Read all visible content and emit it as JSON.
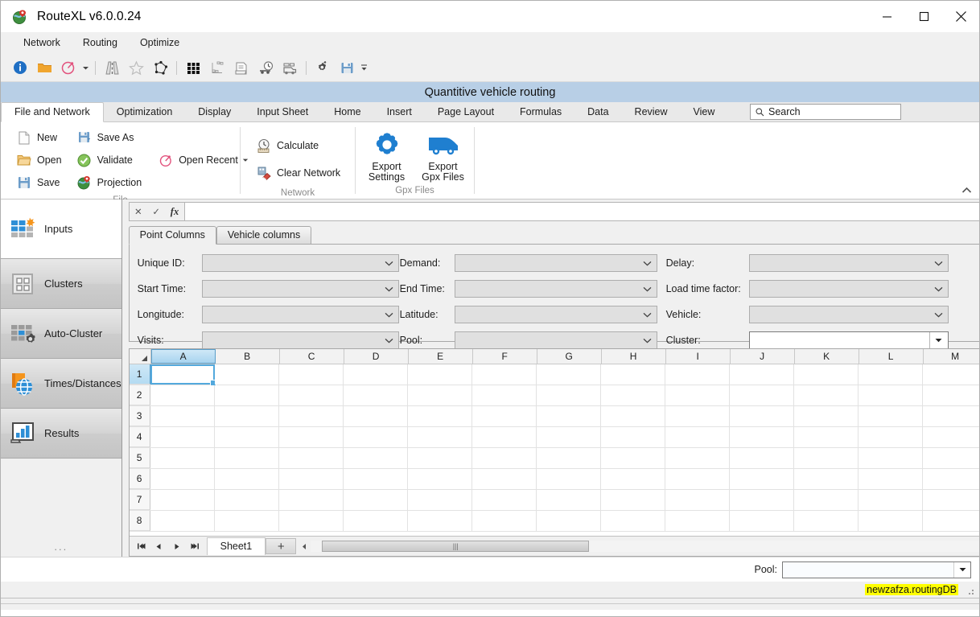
{
  "window": {
    "title": "RouteXL v6.0.0.24",
    "app_icon": "globe-marker-icon",
    "minimize": "minimize-icon",
    "maximize": "maximize-icon",
    "close": "close-icon"
  },
  "menubar": {
    "items": [
      {
        "label": "Network"
      },
      {
        "label": "Routing"
      },
      {
        "label": "Optimize"
      }
    ]
  },
  "toolstrip": {
    "buttons": [
      {
        "name": "info-icon"
      },
      {
        "name": "open-folder-icon"
      },
      {
        "name": "compass-icon"
      },
      {
        "name": "compass-dropdown-caret-icon"
      },
      {
        "name": "separator-1"
      },
      {
        "name": "road-icon"
      },
      {
        "name": "star-icon"
      },
      {
        "name": "polygon-icon"
      },
      {
        "name": "separator-2"
      },
      {
        "name": "matrix-grid-icon"
      },
      {
        "name": "cluster-nodes-icon"
      },
      {
        "name": "report-icon"
      },
      {
        "name": "truck-clock-icon"
      },
      {
        "name": "truck-fleet-icon"
      },
      {
        "name": "separator-3"
      },
      {
        "name": "gears-settings-icon"
      },
      {
        "name": "save-disk-icon"
      },
      {
        "name": "overflow-caret-icon"
      }
    ]
  },
  "banner": {
    "title": "Quantitive vehicle routing"
  },
  "ribbon": {
    "tabs": [
      {
        "label": "File and Network",
        "active": true
      },
      {
        "label": "Optimization",
        "active": false
      },
      {
        "label": "Display",
        "active": false
      },
      {
        "label": "Input Sheet",
        "active": false
      },
      {
        "label": "Home",
        "active": false
      },
      {
        "label": "Insert",
        "active": false
      },
      {
        "label": "Page Layout",
        "active": false
      },
      {
        "label": "Formulas",
        "active": false
      },
      {
        "label": "Data",
        "active": false
      },
      {
        "label": "Review",
        "active": false
      },
      {
        "label": "View",
        "active": false
      }
    ],
    "search": {
      "placeholder": "Search",
      "value": "Search",
      "icon": "search-icon"
    },
    "collapse_icon": "chevron-up-icon",
    "groups": [
      {
        "label": "File",
        "columns": [
          {
            "buttons": [
              {
                "label": "New",
                "icon": "new-document-icon"
              },
              {
                "label": "Open",
                "icon": "open-folder-icon"
              },
              {
                "label": "Save",
                "icon": "save-disk-icon"
              }
            ]
          },
          {
            "buttons": [
              {
                "label": "Save As",
                "icon": "save-as-disk-icon"
              },
              {
                "label": "Validate",
                "icon": "green-check-icon"
              },
              {
                "label": "Projection",
                "icon": "globe-marker-icon"
              }
            ]
          },
          {
            "buttons": [
              {
                "label": "Open Recent",
                "icon": "compass-icon",
                "has_caret": true
              }
            ]
          }
        ]
      },
      {
        "label": "Network",
        "columns": [
          {
            "buttons": [
              {
                "label": "Calculate",
                "icon": "clock-ruler-icon"
              },
              {
                "label": "Clear Network",
                "icon": "eraser-icon"
              }
            ]
          }
        ]
      },
      {
        "label": "Gpx Files",
        "big_buttons": [
          {
            "label": "Export\nSettings",
            "line1": "Export",
            "line2": "Settings",
            "icon": "gear-icon"
          },
          {
            "label": "Export\nGpx Files",
            "line1": "Export",
            "line2": "Gpx Files",
            "icon": "van-icon"
          }
        ]
      }
    ]
  },
  "navpane": {
    "items": [
      {
        "label": "Inputs",
        "icon": "inputs-grid-star-icon",
        "active": true
      },
      {
        "label": "Clusters",
        "icon": "clusters-icon",
        "active": false
      },
      {
        "label": "Auto-Cluster",
        "icon": "auto-cluster-gear-icon",
        "active": false
      },
      {
        "label": "Times/Distances",
        "icon": "times-distances-globe-icon",
        "active": false
      },
      {
        "label": "Results",
        "icon": "results-chart-icon",
        "active": false
      }
    ],
    "overflow": "..."
  },
  "formula_bar": {
    "cancel_icon": "cancel-x-icon",
    "accept_icon": "accept-check-icon",
    "function_icon": "insert-function-icon",
    "value": "",
    "expand_icon": "chevron-down-icon"
  },
  "panel": {
    "tabs": [
      {
        "label": "Point Columns",
        "active": true
      },
      {
        "label": "Vehicle columns",
        "active": false
      }
    ],
    "fields": [
      {
        "label": "Unique ID:",
        "value": "",
        "style": "grey",
        "col": 0,
        "row": 0,
        "icon": "chevron-down-icon"
      },
      {
        "label": "Demand:",
        "value": "",
        "style": "grey",
        "col": 1,
        "row": 0,
        "icon": "chevron-down-icon"
      },
      {
        "label": "Delay:",
        "value": "",
        "style": "grey",
        "col": 2,
        "row": 0,
        "icon": "chevron-down-icon"
      },
      {
        "label": "Start Time:",
        "value": "",
        "style": "grey",
        "col": 0,
        "row": 1,
        "icon": "chevron-down-icon"
      },
      {
        "label": "End Time:",
        "value": "",
        "style": "grey",
        "col": 1,
        "row": 1,
        "icon": "chevron-down-icon"
      },
      {
        "label": "Load time factor:",
        "value": "",
        "style": "grey",
        "col": 2,
        "row": 1,
        "icon": "chevron-down-icon"
      },
      {
        "label": "Longitude:",
        "value": "",
        "style": "grey",
        "col": 0,
        "row": 2,
        "icon": "chevron-down-icon"
      },
      {
        "label": "Latitude:",
        "value": "",
        "style": "grey",
        "col": 1,
        "row": 2,
        "icon": "chevron-down-icon"
      },
      {
        "label": "Vehicle:",
        "value": "",
        "style": "grey",
        "col": 2,
        "row": 2,
        "icon": "chevron-down-icon"
      },
      {
        "label": "Visits:",
        "value": "",
        "style": "grey",
        "col": 0,
        "row": 3,
        "icon": "chevron-down-icon"
      },
      {
        "label": "Pool:",
        "value": "",
        "style": "grey",
        "col": 1,
        "row": 3,
        "icon": "chevron-down-icon"
      },
      {
        "label": "Cluster:",
        "value": "",
        "style": "white",
        "col": 2,
        "row": 3,
        "icon": "triangle-down-icon"
      }
    ]
  },
  "grid": {
    "columns": [
      "A",
      "B",
      "C",
      "D",
      "E",
      "F",
      "G",
      "H",
      "I",
      "J",
      "K",
      "L",
      "M"
    ],
    "selected_column": "A",
    "rows": [
      "1",
      "2",
      "3",
      "4",
      "5",
      "6",
      "7",
      "8"
    ],
    "active_cell": "A1",
    "scrollbar": {
      "up_icon": "scroll-up-icon",
      "down_icon": "scroll-down-icon",
      "grip": "scroll-grip-icon"
    }
  },
  "sheetbar": {
    "nav": [
      {
        "name": "first-sheet-icon",
        "glyph": "⏮"
      },
      {
        "name": "prev-sheet-icon",
        "glyph": "◀"
      },
      {
        "name": "next-sheet-icon",
        "glyph": "▶"
      },
      {
        "name": "last-sheet-icon",
        "glyph": "⏭"
      }
    ],
    "tabs": [
      {
        "label": "Sheet1",
        "active": true
      }
    ],
    "add_label": "+",
    "hscroll": {
      "left_icon": "scroll-left-icon",
      "right_icon": "scroll-right-icon",
      "grip": "scroll-grip-icon"
    }
  },
  "poolbar": {
    "label": "Pool:",
    "value": "",
    "dropdown_icon": "triangle-down-icon"
  },
  "statusbar": {
    "database": "newzafza.routingDB",
    "database_highlight": "#ffff00",
    "resize_grip": "resize-grip-icon"
  },
  "colors": {
    "banner": "#b8cfe6",
    "accent_blue": "#1f7fd0",
    "selection_blue": "#53a9dd",
    "orange": "#f59b2a",
    "green": "#5cb533",
    "highlight_yellow": "#ffff00"
  }
}
